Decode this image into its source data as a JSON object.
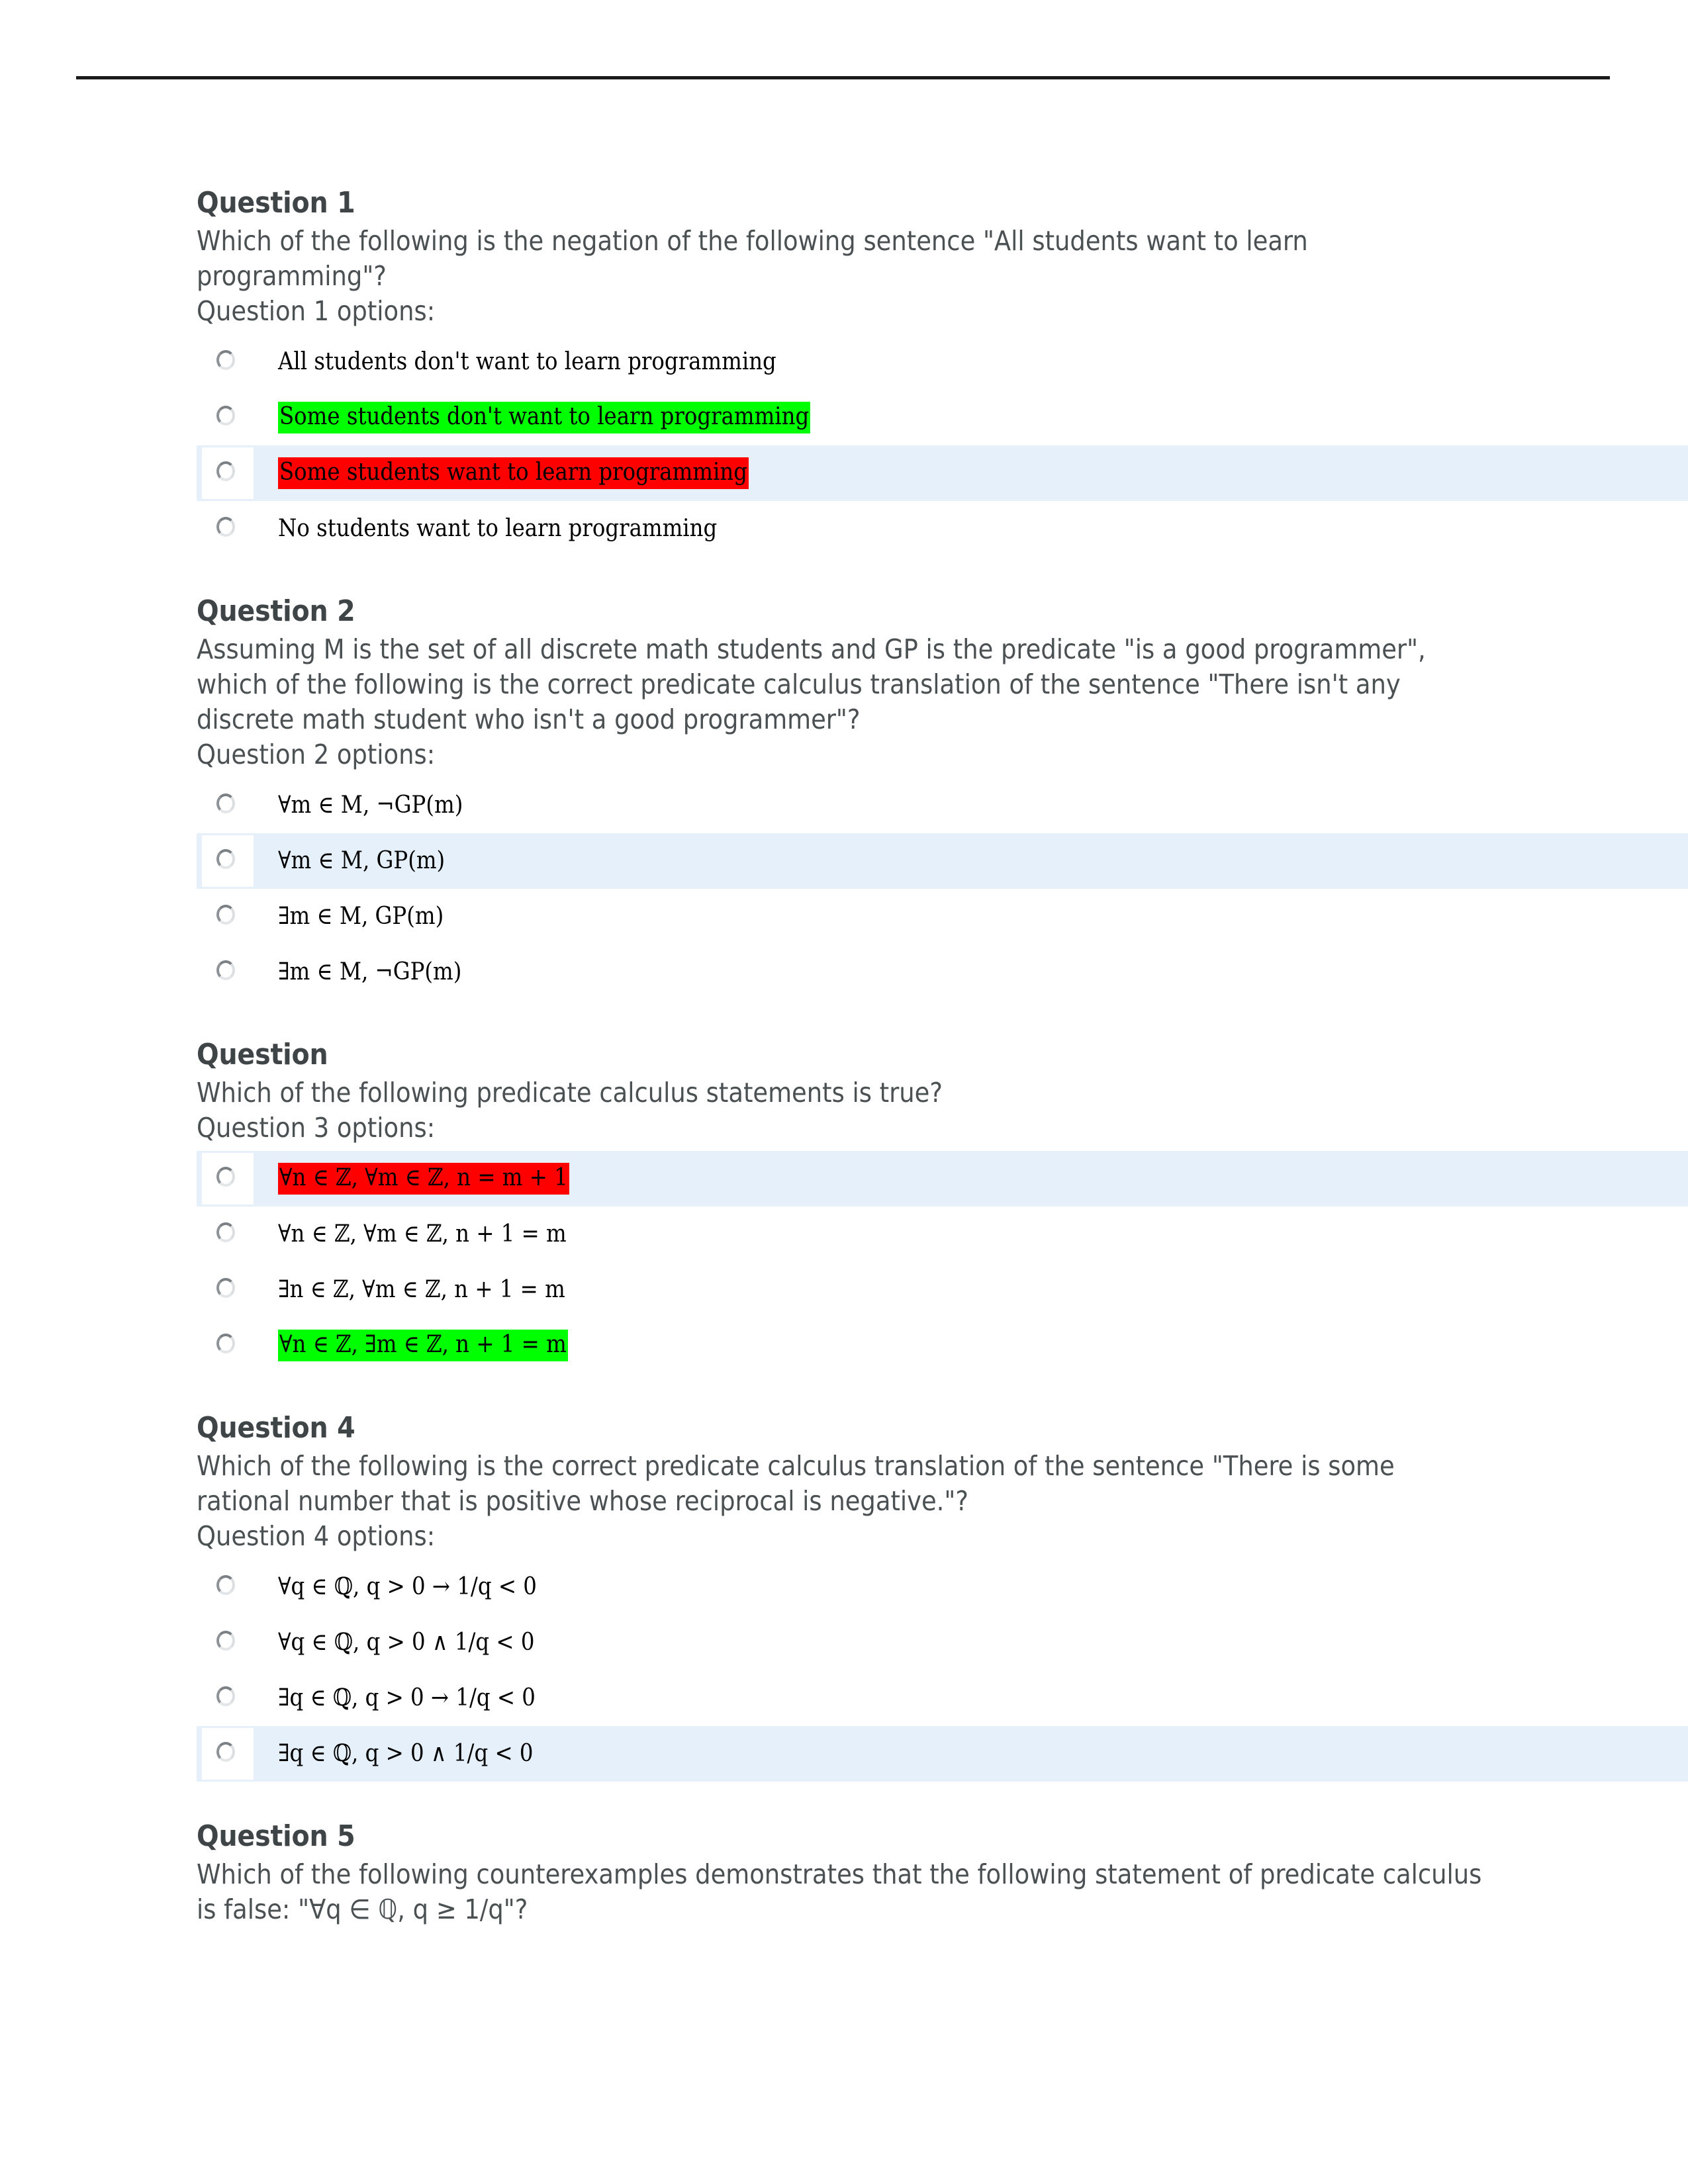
{
  "page": {
    "has_top_rule": true,
    "background_color": "#ffffff",
    "text_color": "#4b5053",
    "selected_row_color": "#e6f0fa",
    "highlight_green": "#00ff00",
    "highlight_red": "#ff0000"
  },
  "questions": [
    {
      "title": "Question 1",
      "body": "Which of the following is the negation of the following sentence \"All students want to learn programming\"?",
      "options_label": "Question 1 options:",
      "options": [
        {
          "text": "All students don't want to learn programming",
          "highlight": "none",
          "selected": false
        },
        {
          "text": "Some students don't want to learn programming",
          "highlight": "green",
          "selected": false
        },
        {
          "text": "Some students want to learn programming",
          "highlight": "red",
          "selected": true
        },
        {
          "text": "No students want to learn programming",
          "highlight": "none",
          "selected": false
        }
      ]
    },
    {
      "title": "Question 2",
      "body": "Assuming M is the set of all discrete math students and GP is the predicate \"is a good programmer\", which of the following is the correct predicate calculus translation of the sentence \"There isn't any discrete math student who isn't a good programmer\"?",
      "options_label": "Question 2 options:",
      "options": [
        {
          "text": "∀m ∈ M, ¬GP(m)",
          "highlight": "none",
          "selected": false
        },
        {
          "text": "∀m ∈ M, GP(m)",
          "highlight": "none",
          "selected": true
        },
        {
          "text": "∃m ∈ M, GP(m)",
          "highlight": "none",
          "selected": false
        },
        {
          "text": "∃m ∈ M, ¬GP(m)",
          "highlight": "none",
          "selected": false
        }
      ]
    },
    {
      "title": "Question",
      "body": "Which of the following predicate calculus statements is true?",
      "options_label": "Question 3 options:",
      "options": [
        {
          "text": "∀n ∈ ℤ, ∀m ∈ ℤ, n = m + 1",
          "highlight": "red",
          "selected": true
        },
        {
          "text": "∀n ∈ ℤ, ∀m ∈ ℤ, n + 1 = m",
          "highlight": "none",
          "selected": false
        },
        {
          "text": "∃n ∈ ℤ, ∀m ∈ ℤ, n + 1 = m",
          "highlight": "none",
          "selected": false
        },
        {
          "text": "∀n ∈ ℤ, ∃m ∈ ℤ, n + 1 = m",
          "highlight": "green",
          "selected": false
        }
      ]
    },
    {
      "title": "Question 4",
      "body": "Which of the following is the correct predicate calculus translation of the sentence \"There is some rational number that is positive whose reciprocal is negative.\"?",
      "options_label": "Question 4 options:",
      "options": [
        {
          "text": "∀q ∈ ℚ, q > 0 → 1/q < 0",
          "highlight": "none",
          "selected": false
        },
        {
          "text": "∀q ∈ ℚ, q > 0 ∧ 1/q < 0",
          "highlight": "none",
          "selected": false
        },
        {
          "text": "∃q ∈ ℚ, q > 0 → 1/q < 0",
          "highlight": "none",
          "selected": false
        },
        {
          "text": "∃q ∈ ℚ, q > 0 ∧ 1/q < 0",
          "highlight": "none",
          "selected": true
        }
      ]
    },
    {
      "title": "Question 5",
      "body": "Which of the following counterexamples demonstrates that the following statement of predicate calculus is false: \"∀q ∈ ℚ, q ≥ 1/q\"?",
      "options_label": "",
      "options": []
    }
  ]
}
